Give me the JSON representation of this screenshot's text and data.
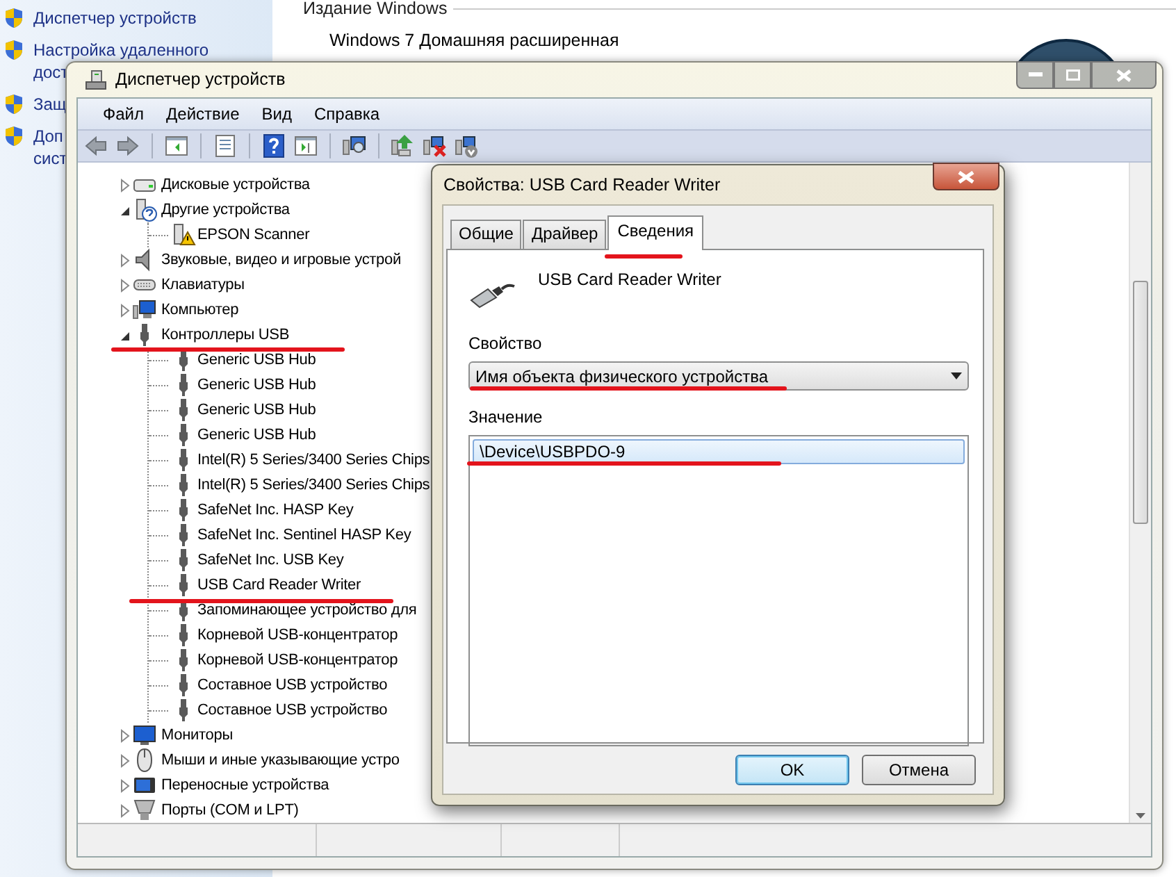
{
  "desktop": {
    "sidebar": {
      "items": [
        {
          "lines": [
            "Диспетчер устройств"
          ]
        },
        {
          "lines": [
            "Настройка удаленного",
            "дост"
          ]
        },
        {
          "lines": [
            "Защ"
          ]
        },
        {
          "lines": [
            "Доп",
            "сист"
          ]
        }
      ]
    },
    "edition": {
      "heading": "Издание Windows",
      "value": "Windows 7 Домашняя расширенная"
    }
  },
  "device_manager": {
    "title": "Диспетчер устройств",
    "menu": [
      "Файл",
      "Действие",
      "Вид",
      "Справка"
    ],
    "tree": [
      {
        "label": "Дисковые устройства",
        "kind": "disk",
        "expanded": false
      },
      {
        "label": "Другие устройства",
        "kind": "other",
        "expanded": true,
        "children": [
          {
            "label": "EPSON Scanner",
            "kind": "warning"
          }
        ]
      },
      {
        "label": "Звуковые, видео и игровые устрой",
        "kind": "audio",
        "expanded": false
      },
      {
        "label": "Клавиатуры",
        "kind": "keyboard",
        "expanded": false
      },
      {
        "label": "Компьютер",
        "kind": "computer",
        "expanded": false
      },
      {
        "label": "Контроллеры USB",
        "kind": "usb",
        "expanded": true,
        "children": [
          {
            "label": "Generic USB Hub",
            "kind": "usb"
          },
          {
            "label": "Generic USB Hub",
            "kind": "usb"
          },
          {
            "label": "Generic USB Hub",
            "kind": "usb"
          },
          {
            "label": "Generic USB Hub",
            "kind": "usb"
          },
          {
            "label": "Intel(R) 5 Series/3400 Series Chips",
            "kind": "usb"
          },
          {
            "label": "Intel(R) 5 Series/3400 Series Chips",
            "kind": "usb"
          },
          {
            "label": "SafeNet Inc. HASP Key",
            "kind": "usb"
          },
          {
            "label": "SafeNet Inc. Sentinel HASP Key",
            "kind": "usb"
          },
          {
            "label": "SafeNet Inc. USB Key",
            "kind": "usb"
          },
          {
            "label": "USB Card Reader Writer",
            "kind": "usb"
          },
          {
            "label": "Запоминающее устройство для",
            "kind": "usb"
          },
          {
            "label": "Корневой USB-концентратор",
            "kind": "usb"
          },
          {
            "label": "Корневой USB-концентратор",
            "kind": "usb"
          },
          {
            "label": "Составное USB устройство",
            "kind": "usb"
          },
          {
            "label": "Составное USB устройство",
            "kind": "usb"
          }
        ]
      },
      {
        "label": "Мониторы",
        "kind": "monitor",
        "expanded": false
      },
      {
        "label": "Мыши и иные указывающие устро",
        "kind": "mouse",
        "expanded": false
      },
      {
        "label": "Переносные устройства",
        "kind": "portable",
        "expanded": false
      },
      {
        "label": "Порты (COM и LPT)",
        "kind": "port",
        "expanded": false
      }
    ]
  },
  "properties_dialog": {
    "title": "Свойства: USB Card Reader Writer",
    "tabs": [
      {
        "label": "Общие",
        "selected": false
      },
      {
        "label": "Драйвер",
        "selected": false
      },
      {
        "label": "Сведения",
        "selected": true
      }
    ],
    "device_name": "USB Card Reader Writer",
    "property_label": "Свойство",
    "property_value": "Имя объекта физического устройства",
    "value_label": "Значение",
    "values": [
      {
        "text": "\\Device\\USBPDO-9",
        "selected": true
      }
    ],
    "buttons": [
      {
        "label": "OK",
        "default": true
      },
      {
        "label": "Отмена",
        "default": false
      }
    ]
  }
}
